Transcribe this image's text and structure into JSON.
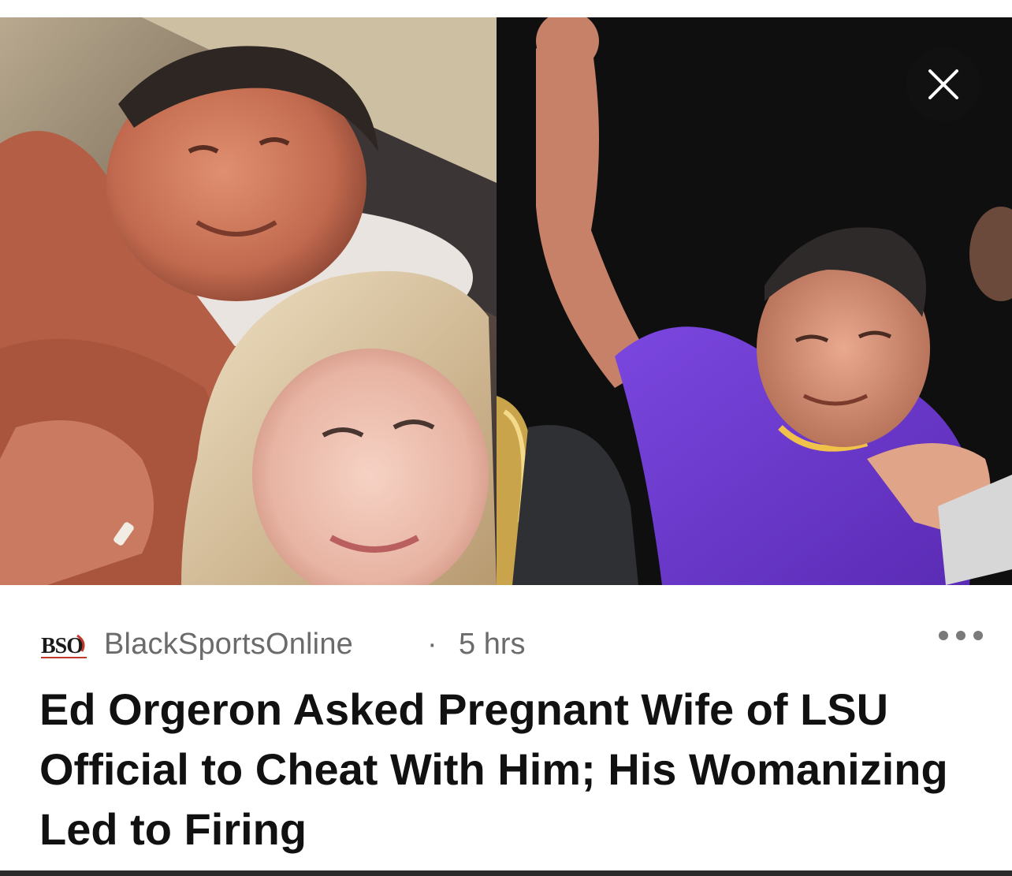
{
  "article": {
    "source_name": "BlackSportsOnline",
    "source_logo_text": "BSO",
    "separator": "·",
    "time_ago": "5 hrs",
    "headline": "Ed Orgeron Asked Pregnant Wife of LSU Official to Cheat With Him; His Womanizing Led to Firing",
    "close_icon": "close-icon",
    "more_icon": "more-horizontal-icon"
  },
  "colors": {
    "meta_text": "#6b6b6b",
    "headline_text": "#111111",
    "jersey_purple": "#6a35c9"
  }
}
